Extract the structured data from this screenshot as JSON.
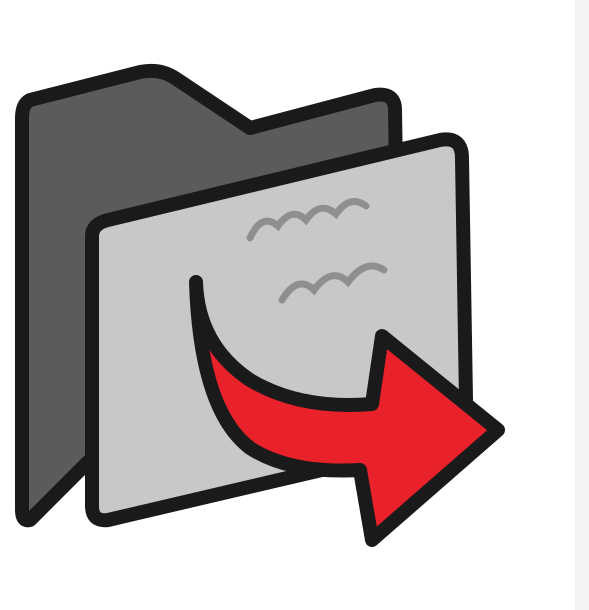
{
  "icon": {
    "name": "folder-export-icon",
    "folder_back_color": "#5b5b5b",
    "folder_front_color": "#c8c8c8",
    "outline_color": "#1a1a1a",
    "arrow_color": "#e8212b",
    "side_strip_color": "#f2f3f5"
  }
}
